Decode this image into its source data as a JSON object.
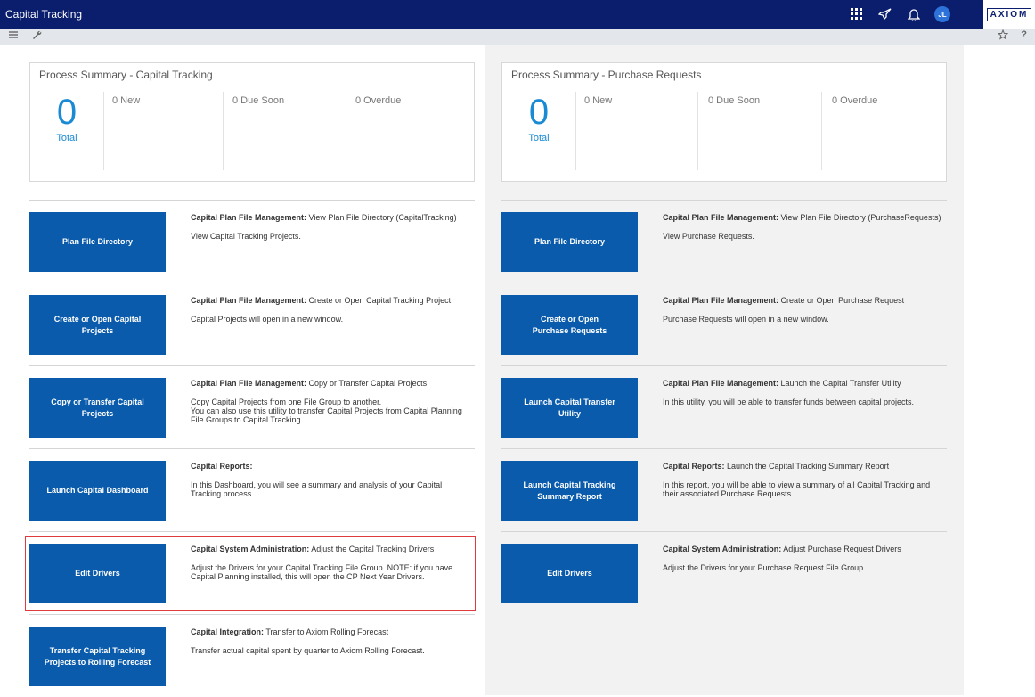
{
  "app": {
    "title": "Capital Tracking",
    "brand": "AXIOM",
    "avatar_initials": "JL",
    "icons": [
      "apps-grid-icon",
      "rocket-icon",
      "bell-icon"
    ]
  },
  "toolbar": {
    "left_icons": [
      "menu-icon",
      "wrench-icon"
    ],
    "right_icons": [
      "star-icon",
      "help-icon"
    ]
  },
  "left": {
    "summary": {
      "title": "Process Summary - Capital Tracking",
      "total_value": "0",
      "total_label": "Total",
      "new_label": "0 New",
      "due_soon_label": "0 Due Soon",
      "overdue_label": "0 Overdue"
    },
    "rows": [
      {
        "button": "Plan File Directory",
        "head_bold": "Capital Plan File Management:",
        "head_rest": " View Plan File Directory (CapitalTracking)",
        "body": "View Capital Tracking Projects."
      },
      {
        "button": "Create or Open Capital Projects",
        "head_bold": "Capital Plan File Management:",
        "head_rest": " Create or Open Capital Tracking Project",
        "body": "Capital Projects will open in a new window."
      },
      {
        "button": "Copy or Transfer Capital\nProjects",
        "head_bold": "Capital Plan File Management:",
        "head_rest": " Copy or Transfer Capital Projects",
        "body": "Copy Capital Projects from one File Group to another.\nYou can also use this utility to transfer Capital Projects from Capital Planning File Groups to Capital Tracking."
      },
      {
        "button": "Launch Capital Dashboard",
        "head_bold": "Capital Reports:",
        "head_rest": "",
        "body": "In this Dashboard, you will see a summary and analysis of your Capital Tracking process."
      },
      {
        "button": "Edit Drivers",
        "head_bold": "Capital System Administration:",
        "head_rest": " Adjust the Capital Tracking Drivers",
        "body": "Adjust the Drivers for your Capital Tracking File Group. NOTE: if you have Capital Planning installed, this will open the CP Next Year Drivers."
      },
      {
        "button": "Transfer Capital Tracking\nProjects to Rolling Forecast",
        "head_bold": "Capital Integration:",
        "head_rest": " Transfer to Axiom Rolling Forecast",
        "body": "Transfer actual capital spent by quarter to Axiom Rolling Forecast."
      }
    ]
  },
  "right": {
    "summary": {
      "title": "Process Summary - Purchase Requests",
      "total_value": "0",
      "total_label": "Total",
      "new_label": "0 New",
      "due_soon_label": "0 Due Soon",
      "overdue_label": "0 Overdue"
    },
    "rows": [
      {
        "button": "Plan File Directory",
        "head_bold": "Capital Plan File Management:",
        "head_rest": " View Plan File Directory (PurchaseRequests)",
        "body": "View Purchase Requests."
      },
      {
        "button": "Create or Open\nPurchase Requests",
        "head_bold": "Capital Plan File Management:",
        "head_rest": " Create or Open Purchase Request",
        "body": "Purchase Requests will open in a new window."
      },
      {
        "button": "Launch Capital Transfer Utility",
        "head_bold": "Capital Plan File Management:",
        "head_rest": " Launch the Capital Transfer Utility",
        "body": "In this utility, you will be able to transfer funds between capital projects."
      },
      {
        "button": "Launch Capital Tracking\nSummary Report",
        "head_bold": "Capital Reports:",
        "head_rest": " Launch the Capital Tracking Summary Report",
        "body": "In this report, you will be able to view a summary of all Capital Tracking and their associated Purchase Requests."
      },
      {
        "button": "Edit Drivers",
        "head_bold": "Capital System Administration:",
        "head_rest": " Adjust Purchase Request Drivers",
        "body": "Adjust the Drivers for your Purchase Request File Group."
      }
    ]
  }
}
